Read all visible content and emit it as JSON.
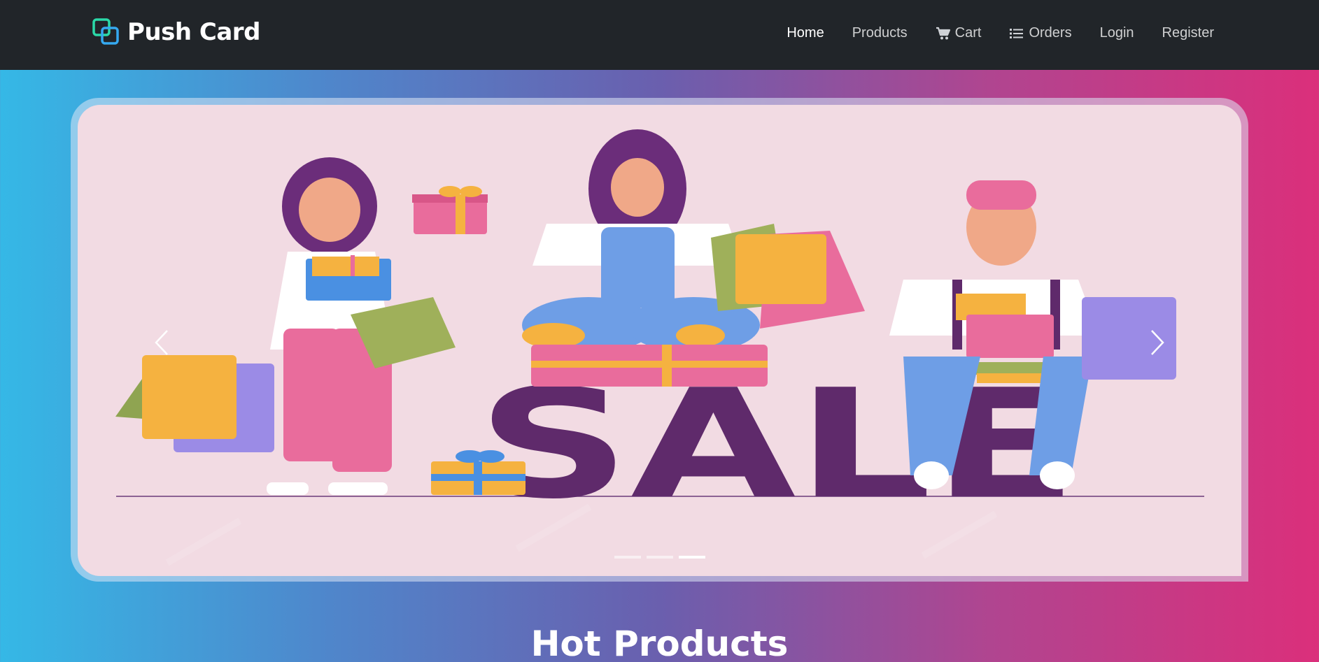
{
  "brand": {
    "name": "Push Card",
    "icon": "layered-squares-logo-icon",
    "icon_colors": [
      "#2bd9a8",
      "#35a9f0"
    ]
  },
  "nav": {
    "items": [
      {
        "label": "Home",
        "icon": "",
        "active": true
      },
      {
        "label": "Products",
        "icon": "",
        "active": false
      },
      {
        "label": "Cart",
        "icon": "cart-icon",
        "active": false
      },
      {
        "label": "Orders",
        "icon": "list-icon",
        "active": false
      },
      {
        "label": "Login",
        "icon": "",
        "active": false
      },
      {
        "label": "Register",
        "icon": "",
        "active": false
      }
    ]
  },
  "carousel": {
    "slide_text": "SALE",
    "slide_count": 3,
    "active_slide": 3,
    "prev_icon": "chevron-left-icon",
    "next_icon": "chevron-right-icon"
  },
  "section": {
    "title": "Hot Products"
  },
  "colors": {
    "navbar": "#212529",
    "slide_bg": "#f2dbe3",
    "sale_text": "#5f2a6b",
    "gradient_start": "#35b8e6",
    "gradient_end": "#db2f7b"
  }
}
